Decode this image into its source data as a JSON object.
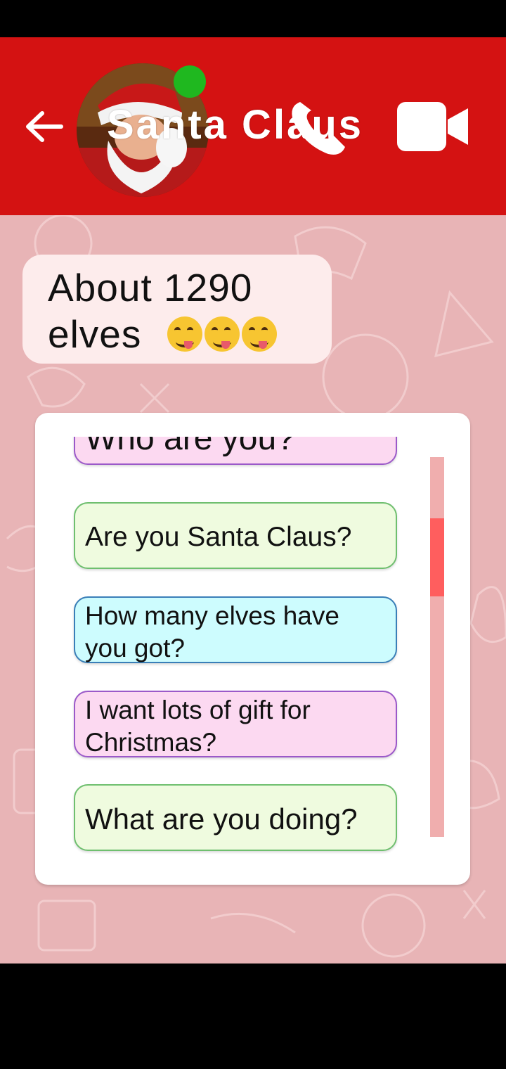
{
  "header": {
    "contact_name": "Santa Claus",
    "online": true,
    "icons": {
      "back": "arrow-left-icon",
      "call": "phone-icon",
      "video": "video-camera-icon"
    }
  },
  "messages": [
    {
      "text_line1": "About 1290",
      "text_line2": "elves",
      "emoji": [
        "yum-face",
        "yum-face",
        "yum-face"
      ]
    }
  ],
  "question_options": [
    {
      "label": "Who are you?",
      "style": "pink"
    },
    {
      "label": "Are you Santa Claus?",
      "style": "green"
    },
    {
      "label": "How many elves have you got?",
      "style": "cyan"
    },
    {
      "label": "I want lots of gift for Christmas?",
      "style": "pink"
    },
    {
      "label": "What are you doing?",
      "style": "green"
    }
  ],
  "scroll": {
    "position_fraction": 0.17
  },
  "colors": {
    "header": "#d41212",
    "online": "#1fb81f",
    "chat_bg": "#e8b4b6",
    "bubble": "#fdecec",
    "scroll_thumb": "#ff5e5e",
    "scroll_track": "#f0aeae"
  }
}
